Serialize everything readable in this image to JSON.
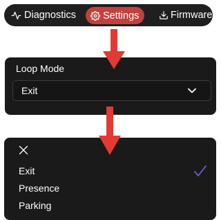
{
  "nav": {
    "items": [
      {
        "label": "Diagnostics",
        "icon": "activity-icon"
      },
      {
        "label": "Settings",
        "icon": "gear-icon",
        "active": true
      },
      {
        "label": "Firmware",
        "icon": "download-icon"
      }
    ],
    "active_color": "#c2403d"
  },
  "loop_mode": {
    "title": "Loop Mode",
    "selected": "Exit"
  },
  "dropdown": {
    "options": [
      "Exit",
      "Presence",
      "Parking"
    ],
    "checked": "Exit",
    "check_color": "#6b5fd3"
  },
  "colors": {
    "arrow": "#e23a32",
    "panel": "#1a1a1a"
  }
}
